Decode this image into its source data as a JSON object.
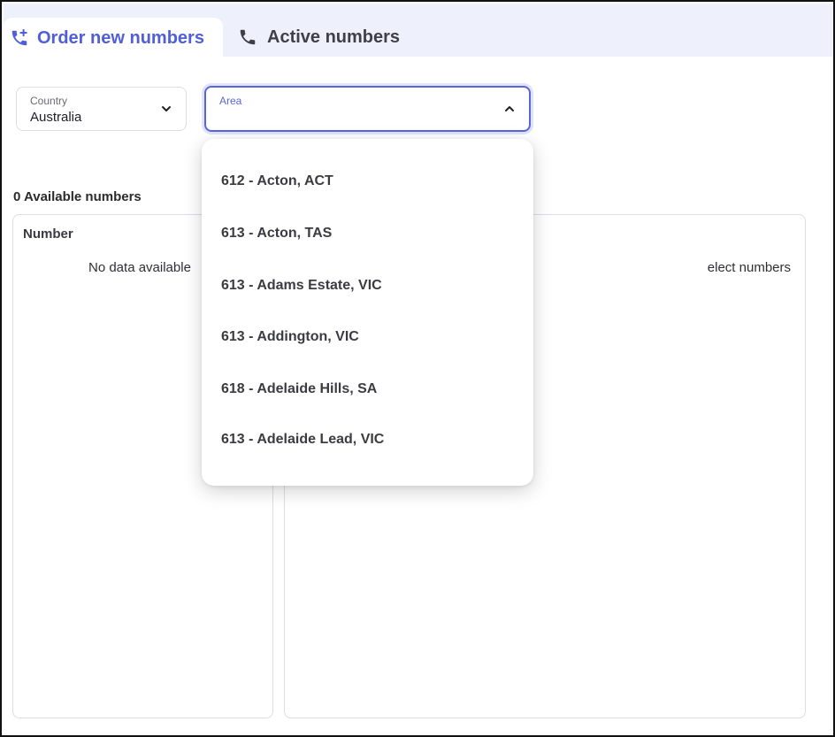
{
  "tabs": [
    {
      "label": "Order new numbers",
      "icon": "phone-plus-icon",
      "active": true
    },
    {
      "label": "Active numbers",
      "icon": "phone-icon",
      "active": false
    }
  ],
  "country": {
    "label": "Country",
    "value": "Australia"
  },
  "area": {
    "label": "Area",
    "value": ""
  },
  "available": {
    "title": "0 Available numbers",
    "column": "Number",
    "empty": "No data available"
  },
  "selected": {
    "hint": "elect numbers"
  },
  "area_options": [
    "612 - Acton, ACT",
    "613 - Acton, TAS",
    "613 - Adams Estate, VIC",
    "613 - Addington, VIC",
    "618 - Adelaide Hills, SA",
    "613 - Adelaide Lead, VIC"
  ],
  "colors": {
    "accent": "#4f5fd8",
    "tab_bg": "#eef1fb",
    "border": "#dcdde3"
  }
}
